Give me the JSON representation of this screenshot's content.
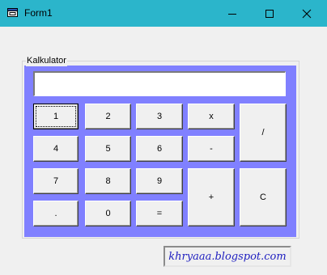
{
  "window": {
    "title": "Form1",
    "titlebar_color": "#2bb5cb",
    "icons": [
      "app-icon",
      "minimize-icon",
      "maximize-icon",
      "close-icon"
    ]
  },
  "calculator": {
    "group_title": "Kalkulator",
    "panel_color": "#8080ff",
    "display_value": "",
    "buttons": {
      "one": "1",
      "two": "2",
      "three": "3",
      "multiply": "x",
      "divide": "/",
      "four": "4",
      "five": "5",
      "six": "6",
      "subtract": "-",
      "seven": "7",
      "eight": "8",
      "nine": "9",
      "add": "+",
      "clear": "C",
      "decimal": ".",
      "zero": "0",
      "equals": "="
    }
  },
  "watermark": {
    "text": "khryaaa.blogspot.com",
    "color": "#2020c0"
  }
}
